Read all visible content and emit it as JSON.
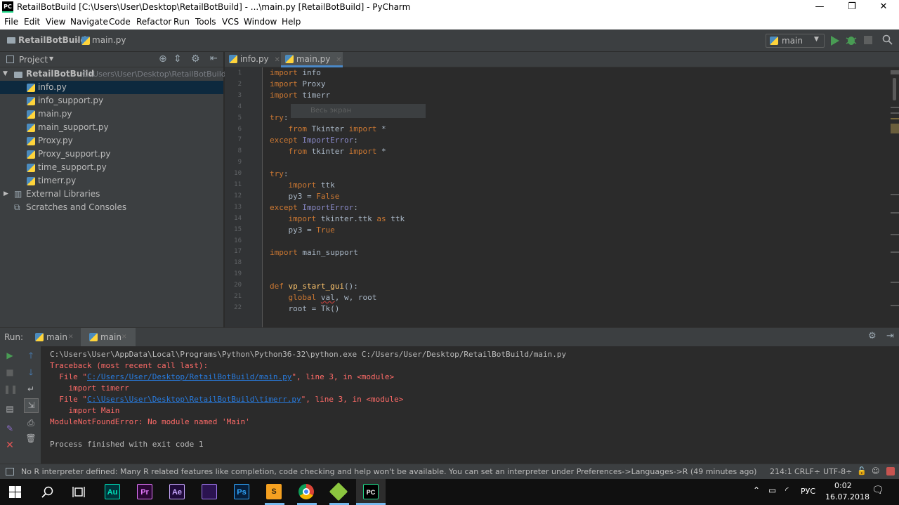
{
  "window": {
    "app_icon": "PC",
    "title": "RetailBotBuild [C:\\Users\\User\\Desktop\\RetailBotBuild] - ...\\main.py [RetailBotBuild] - PyCharm",
    "minimize": "—",
    "maximize": "❐",
    "close": "✕"
  },
  "menu": [
    "File",
    "Edit",
    "View",
    "Navigate",
    "Code",
    "Refactor",
    "Run",
    "Tools",
    "VCS",
    "Window",
    "Help"
  ],
  "navbar": {
    "project": "RetailBotBuild",
    "file": "main.py",
    "run_config": "main"
  },
  "project_panel": {
    "title": "Project",
    "root_name": "RetailBotBuild",
    "root_path": "C:\\Users\\User\\Desktop\\RetailBotBuild",
    "files": [
      "info.py",
      "info_support.py",
      "main.py",
      "main_support.py",
      "Proxy.py",
      "Proxy_support.py",
      "time_support.py",
      "timerr.py"
    ],
    "external": "External Libraries",
    "scratches": "Scratches and Consoles"
  },
  "editor": {
    "tabs": [
      "info.py",
      "main.py"
    ],
    "active_tab": "main.py",
    "tooltip": "Весь экран",
    "line_numbers": [
      "1",
      "2",
      "3",
      "4",
      "5",
      "6",
      "7",
      "8",
      "9",
      "10",
      "11",
      "12",
      "13",
      "14",
      "15",
      "16",
      "17",
      "18",
      "19",
      "20",
      "21",
      "22"
    ]
  },
  "run": {
    "label": "Run:",
    "tabs": [
      "main",
      "main"
    ],
    "console": [
      "C:\\Users\\User\\AppData\\Local\\Programs\\Python\\Python36-32\\python.exe C:/Users/User/Desktop/RetailBotBuild/main.py",
      "Traceback (most recent call last):",
      "  File \"",
      "C:/Users/User/Desktop/RetailBotBuild/main.py",
      "\", line 3, in <module>",
      "    import timerr",
      "  File \"",
      "C:\\Users\\User\\Desktop\\RetailBotBuild\\timerr.py",
      "\", line 3, in <module>",
      "    import Main",
      "ModuleNotFoundError: No module named 'Main'",
      "Process finished with exit code 1"
    ]
  },
  "status": {
    "message": "No R interpreter defined: Many R related features like completion, code checking and help won't be available. You can set an interpreter under Preferences->Languages->R (49 minutes ago)",
    "position": "214:1",
    "line_sep": "CRLF÷",
    "encoding": "UTF-8÷"
  },
  "taskbar": {
    "apps": [
      "Au",
      "Pr",
      "Ae",
      "Ps"
    ],
    "lang": "РУС",
    "time": "0:02",
    "date": "16.07.2018"
  },
  "colors": {
    "accent": "#4a88c7",
    "error": "#ff6b68",
    "run_green": "#499c54"
  }
}
